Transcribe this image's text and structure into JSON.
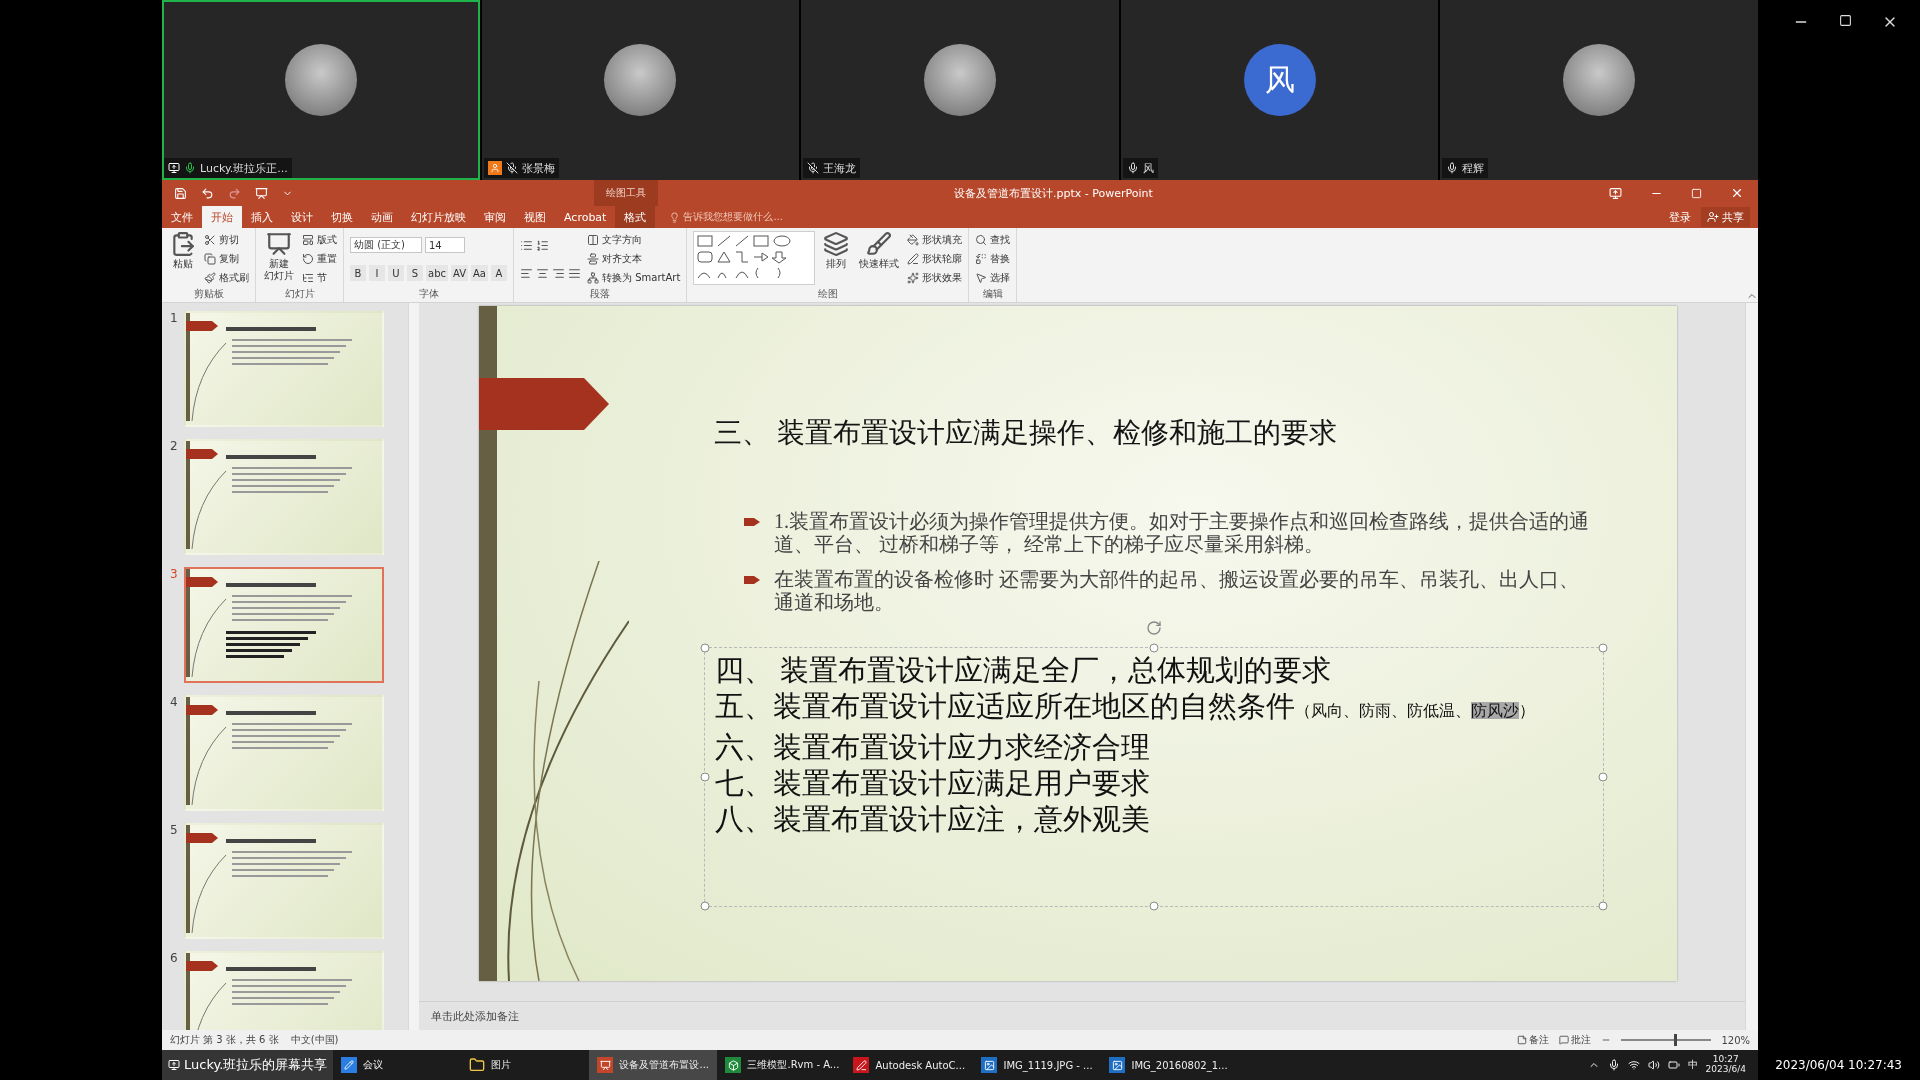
{
  "meeting": {
    "participants": [
      {
        "name": "Lucky.班拉乐正...",
        "kind": "photo",
        "speaking": true,
        "muted": false,
        "sharing": true,
        "profile_badge": false
      },
      {
        "name": "张景梅",
        "kind": "photo",
        "speaking": false,
        "muted": true,
        "sharing": false,
        "profile_badge": true
      },
      {
        "name": "王海龙",
        "kind": "photo",
        "speaking": false,
        "muted": true,
        "sharing": false,
        "profile_badge": false
      },
      {
        "name": "风",
        "kind": "letter",
        "letter": "风",
        "speaking": false,
        "muted": false,
        "sharing": false,
        "profile_badge": false
      },
      {
        "name": "程辉",
        "kind": "photo",
        "speaking": false,
        "muted": false,
        "sharing": false,
        "profile_badge": false
      }
    ]
  },
  "powerpoint": {
    "title": "设备及管道布置设计.pptx - PowerPoint",
    "context_label": "绘图工具",
    "tabs": [
      {
        "label": "文件",
        "selected": false,
        "kind": "normal"
      },
      {
        "label": "开始",
        "selected": true,
        "kind": "normal"
      },
      {
        "label": "插入",
        "selected": false,
        "kind": "normal"
      },
      {
        "label": "设计",
        "selected": false,
        "kind": "normal"
      },
      {
        "label": "切换",
        "selected": false,
        "kind": "normal"
      },
      {
        "label": "动画",
        "selected": false,
        "kind": "normal"
      },
      {
        "label": "幻灯片放映",
        "selected": false,
        "kind": "normal"
      },
      {
        "label": "审阅",
        "selected": false,
        "kind": "normal"
      },
      {
        "label": "视图",
        "selected": false,
        "kind": "normal"
      },
      {
        "label": "Acrobat",
        "selected": false,
        "kind": "normal"
      },
      {
        "label": "格式",
        "selected": false,
        "kind": "context"
      }
    ],
    "tell_me": "告诉我您想要做什么...",
    "sign_in": "登录",
    "share": "共享",
    "ribbon": [
      {
        "kind": "standard",
        "label": "剪贴板",
        "large": [
          {
            "lines": [
              "粘贴"
            ]
          }
        ],
        "small": [
          "剪切",
          "复制",
          "格式刷"
        ]
      },
      {
        "kind": "standard",
        "label": "幻灯片",
        "large": [
          {
            "lines": [
              "新建",
              "幻灯片"
            ]
          }
        ],
        "small": [
          "版式",
          "重置",
          "节"
        ]
      },
      {
        "kind": "font",
        "label": "字体",
        "font_name": "幼圆 (正文)",
        "font_size": "14",
        "format_buttons": [
          "B",
          "I",
          "U",
          "S",
          "abc",
          "AV",
          "Aa",
          "A"
        ]
      },
      {
        "kind": "paragraph",
        "label": "段落",
        "small": [
          "文字方向",
          "对齐文本",
          "转换为 SmartArt"
        ]
      },
      {
        "kind": "drawing",
        "label": "绘图",
        "large": [
          {
            "lines": [
              "排列"
            ]
          },
          {
            "lines": [
              "快速样式"
            ]
          }
        ],
        "small": [
          "形状填充",
          "形状轮廓",
          "形状效果"
        ]
      },
      {
        "kind": "standard",
        "label": "编辑",
        "small": [
          "查找",
          "替换",
          "选择"
        ]
      }
    ],
    "thumbnails": [
      {
        "number": "1",
        "selected": false
      },
      {
        "number": "2",
        "selected": false
      },
      {
        "number": "3",
        "selected": true
      },
      {
        "number": "4",
        "selected": false
      },
      {
        "number": "5",
        "selected": false
      },
      {
        "number": "6",
        "selected": false
      }
    ],
    "slide": {
      "title": "三、 装置布置设计应满足操作、检修和施工的要求",
      "bullets": [
        "1.装置布置设计必须为操作管理提供方便。如对于主要操作点和巡回检查路线，提供合适的通道、平台、 过桥和梯子等， 经常上下的梯子应尽量采用斜梯。",
        "在装置布置的设备检修时 还需要为大部件的起吊、搬运设置必要的吊车、吊装孔、出人口、通道和场地。"
      ],
      "items": [
        {
          "text": "四、 装置布置设计应满足全厂，总体规划的要求"
        },
        {
          "text": "五、装置布置设计应适应所在地区的自然条件",
          "note": [
            {
              "text": "（风向、防雨、防低温、",
              "selected": false
            },
            {
              "text": "防风沙",
              "selected": true
            },
            {
              "text": "）",
              "selected": false
            }
          ]
        },
        {
          "text": "六、装置布置设计应力求经济合理"
        },
        {
          "text": "七、装置布置设计应满足用户要求"
        },
        {
          "text": "八、装置布置设计应注，意外观美"
        }
      ]
    },
    "notes_placeholder": "单击此处添加备注",
    "status_bar": {
      "slide_info": "幻灯片 第 3 张，共 6 张",
      "language": "中文(中国)",
      "notes": "备注",
      "comments": "批注",
      "zoom": "120%",
      "level": 0.6
    }
  },
  "taskbar": {
    "share_label": "Lucky.班拉乐的屏幕共享",
    "items": [
      {
        "label": "会议",
        "kind": "meeting",
        "selected": false
      },
      {
        "label": "图片",
        "kind": "folder",
        "selected": false
      },
      {
        "label": "设备及管道布置设...",
        "kind": "ppt",
        "selected": true
      },
      {
        "label": "三维模型.Rvm - A...",
        "kind": "model",
        "selected": false
      },
      {
        "label": "Autodesk AutoC...",
        "kind": "autocad",
        "selected": false
      },
      {
        "label": "IMG_1119.JPG - ...",
        "kind": "image",
        "selected": false
      },
      {
        "label": "IMG_20160802_1...",
        "kind": "image",
        "selected": false
      }
    ],
    "ime": "中",
    "time": "10:27",
    "date": "2023/6/4"
  },
  "timestamp": "2023/06/04 10:27:43"
}
